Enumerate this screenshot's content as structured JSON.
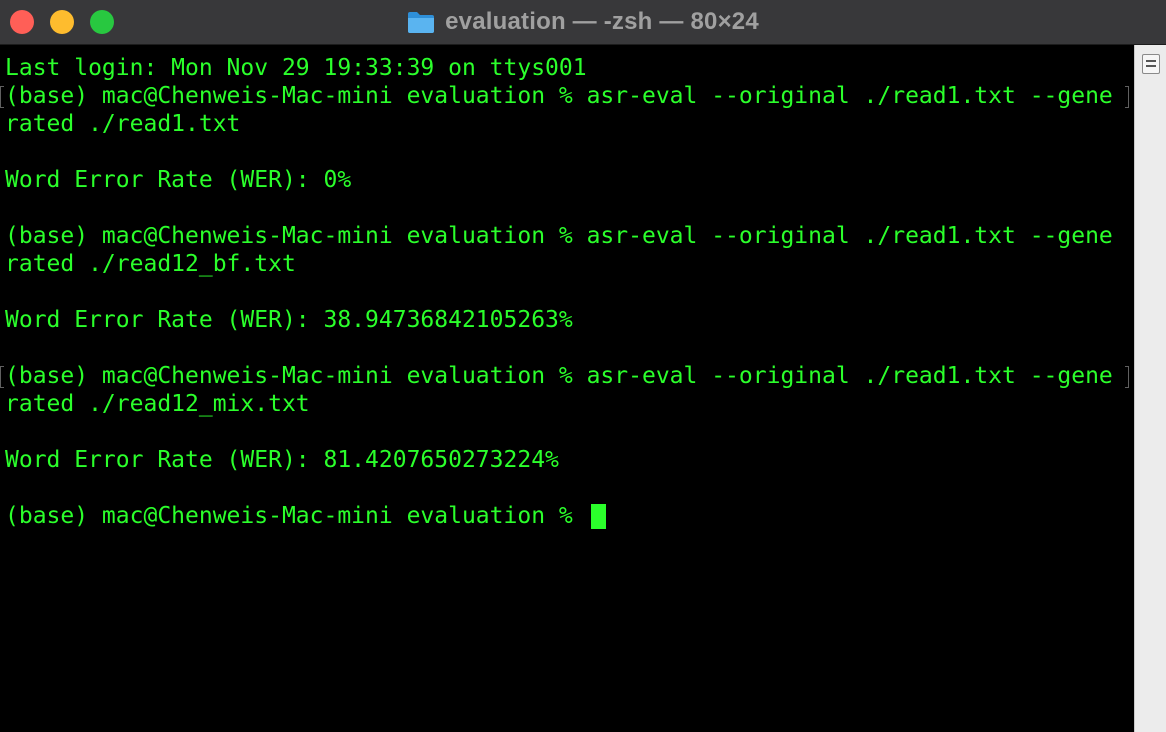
{
  "window": {
    "title": "evaluation — -zsh — 80×24",
    "folder_icon": "folder-icon",
    "accent_green": "#2bff2b"
  },
  "terminal": {
    "lines": [
      "Last login: Mon Nov 29 19:33:39 on ttys001",
      "(base) mac@Chenweis-Mac-mini evaluation % asr-eval --original ./read1.txt --gene",
      "rated ./read1.txt",
      "",
      "Word Error Rate (WER): 0%",
      "",
      "(base) mac@Chenweis-Mac-mini evaluation % asr-eval --original ./read1.txt --gene",
      "rated ./read12_bf.txt",
      "",
      "Word Error Rate (WER): 38.94736842105263%",
      "",
      "(base) mac@Chenweis-Mac-mini evaluation % asr-eval --original ./read1.txt --gene",
      "rated ./read12_mix.txt",
      "",
      "Word Error Rate (WER): 81.4207650273224%",
      "",
      "(base) mac@Chenweis-Mac-mini evaluation % "
    ]
  }
}
